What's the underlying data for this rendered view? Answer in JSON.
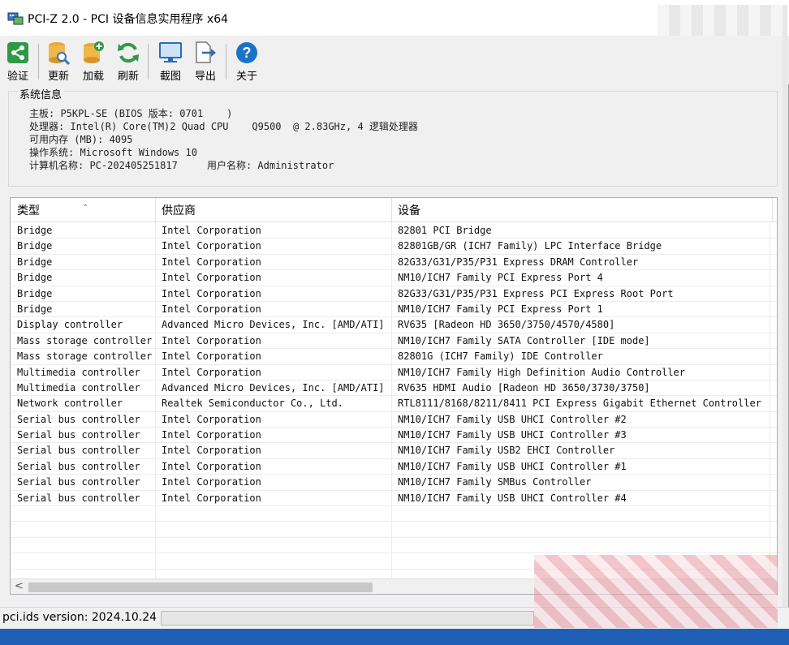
{
  "window": {
    "title": "PCI-Z 2.0  - PCI 设备信息实用程序 x64"
  },
  "toolbar": [
    {
      "label": "验证",
      "icon": "share-icon"
    },
    {
      "label": "更新",
      "icon": "database-search-icon"
    },
    {
      "label": "加载",
      "icon": "database-add-icon"
    },
    {
      "label": "刷新",
      "icon": "refresh-icon"
    },
    {
      "label": "截图",
      "icon": "monitor-icon"
    },
    {
      "label": "导出",
      "icon": "export-icon"
    },
    {
      "label": "关于",
      "icon": "help-icon"
    }
  ],
  "sysinfo": {
    "legend": "系统信息",
    "lines": [
      "主板: P5KPL-SE (BIOS 版本: 0701    )",
      "处理器: Intel(R) Core(TM)2 Quad CPU    Q9500  @ 2.83GHz, 4 逻辑处理器",
      "可用内存 (MB): 4095",
      "操作系统: Microsoft Windows 10",
      "计算机名称: PC-202405251817     用户名称: Administrator"
    ]
  },
  "table": {
    "columns": [
      "类型",
      "供应商",
      "设备"
    ],
    "rows": [
      [
        "Bridge",
        "Intel Corporation",
        "82801 PCI Bridge"
      ],
      [
        "Bridge",
        "Intel Corporation",
        "82801GB/GR (ICH7 Family) LPC Interface Bridge"
      ],
      [
        "Bridge",
        "Intel Corporation",
        "82G33/G31/P35/P31 Express DRAM Controller"
      ],
      [
        "Bridge",
        "Intel Corporation",
        "NM10/ICH7 Family PCI Express Port 4"
      ],
      [
        "Bridge",
        "Intel Corporation",
        "82G33/G31/P35/P31 Express PCI Express Root Port"
      ],
      [
        "Bridge",
        "Intel Corporation",
        "NM10/ICH7 Family PCI Express Port 1"
      ],
      [
        "Display controller",
        "Advanced Micro Devices, Inc. [AMD/ATI]",
        "RV635 [Radeon HD 3650/3750/4570/4580]"
      ],
      [
        "Mass storage controller",
        "Intel Corporation",
        "NM10/ICH7 Family SATA Controller [IDE mode]"
      ],
      [
        "Mass storage controller",
        "Intel Corporation",
        "82801G (ICH7 Family) IDE Controller"
      ],
      [
        "Multimedia controller",
        "Intel Corporation",
        "NM10/ICH7 Family High Definition Audio Controller"
      ],
      [
        "Multimedia controller",
        "Advanced Micro Devices, Inc. [AMD/ATI]",
        "RV635 HDMI Audio [Radeon HD 3650/3730/3750]"
      ],
      [
        "Network controller",
        "Realtek Semiconductor Co., Ltd.",
        "RTL8111/8168/8211/8411 PCI Express Gigabit Ethernet Controller"
      ],
      [
        "Serial bus controller",
        "Intel Corporation",
        "NM10/ICH7 Family USB UHCI Controller #2"
      ],
      [
        "Serial bus controller",
        "Intel Corporation",
        "NM10/ICH7 Family USB UHCI Controller #3"
      ],
      [
        "Serial bus controller",
        "Intel Corporation",
        "NM10/ICH7 Family USB2 EHCI Controller"
      ],
      [
        "Serial bus controller",
        "Intel Corporation",
        "NM10/ICH7 Family USB UHCI Controller #1"
      ],
      [
        "Serial bus controller",
        "Intel Corporation",
        "NM10/ICH7 Family SMBus Controller"
      ],
      [
        "Serial bus controller",
        "Intel Corporation",
        "NM10/ICH7 Family USB UHCI Controller #4"
      ]
    ]
  },
  "status": {
    "text": "pci.ids version: 2024.10.24"
  },
  "colors": {
    "accent": "#1a73c8",
    "green": "#2e9a48",
    "orange": "#e0a030"
  }
}
